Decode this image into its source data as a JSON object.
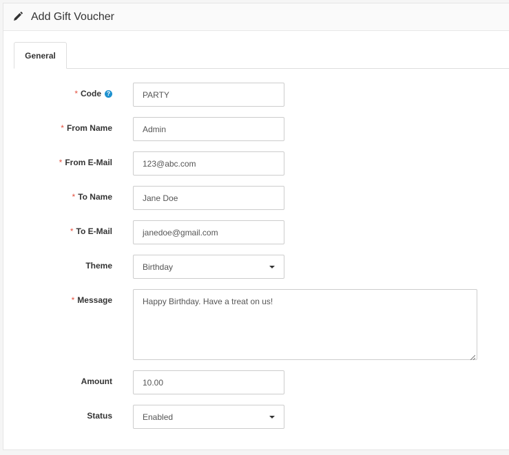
{
  "header": {
    "title": "Add Gift Voucher",
    "icon": "pencil-icon"
  },
  "tabs": [
    {
      "label": "General"
    }
  ],
  "form": {
    "code": {
      "label": "Code",
      "value": "PARTY",
      "required": true
    },
    "from_name": {
      "label": "From Name",
      "value": "Admin",
      "required": true
    },
    "from_email": {
      "label": "From E-Mail",
      "value": "123@abc.com",
      "required": true
    },
    "to_name": {
      "label": "To Name",
      "value": "Jane Doe",
      "required": true
    },
    "to_email": {
      "label": "To E-Mail",
      "value": "janedoe@gmail.com",
      "required": true
    },
    "theme": {
      "label": "Theme",
      "value": "Birthday"
    },
    "message": {
      "label": "Message",
      "value": "Happy Birthday. Have a treat on us!",
      "required": true
    },
    "amount": {
      "label": "Amount",
      "value": "10.00"
    },
    "status": {
      "label": "Status",
      "value": "Enabled"
    }
  },
  "required_marker": "*",
  "help_glyph": "?",
  "colors": {
    "required": "#e3503e",
    "help_icon": "#1e91cf"
  }
}
